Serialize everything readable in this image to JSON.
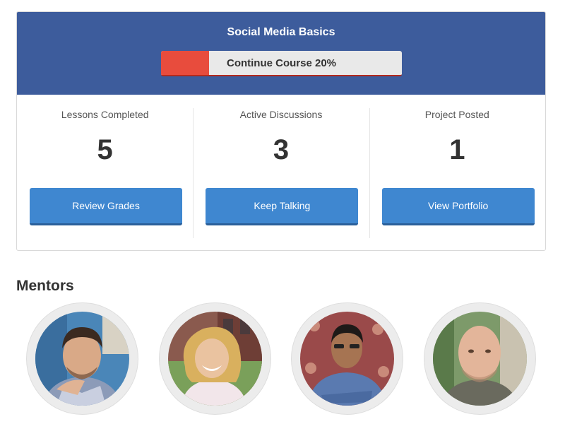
{
  "course": {
    "title": "Social Media Basics",
    "progress_label": "Continue Course 20%",
    "progress_percent": 20
  },
  "stats": [
    {
      "label": "Lessons Completed",
      "value": "5",
      "button_label": "Review Grades"
    },
    {
      "label": "Active Discussions",
      "value": "3",
      "button_label": "Keep Talking"
    },
    {
      "label": "Project Posted",
      "value": "1",
      "button_label": "View Portfolio"
    }
  ],
  "mentors": {
    "title": "Mentors"
  },
  "colors": {
    "header": "#3d5c9c",
    "progress_fill": "#e84c3d",
    "button": "#3f87d0"
  }
}
